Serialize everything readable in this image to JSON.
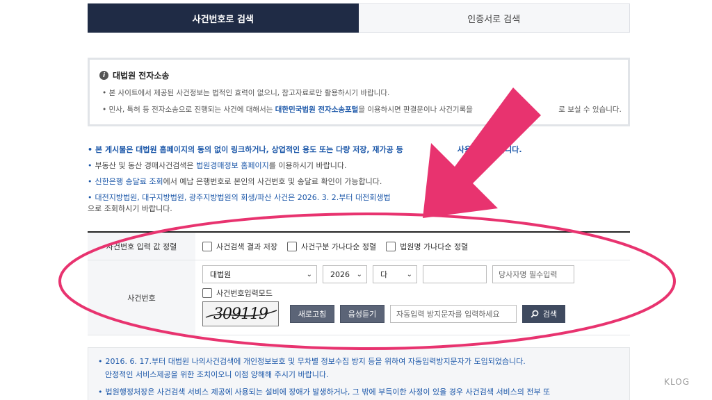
{
  "tabs": [
    {
      "label": "사건번호로 검색",
      "active": true
    },
    {
      "label": "인증서로 검색",
      "active": false
    }
  ],
  "notice": {
    "title": "대법원 전자소송",
    "line1": "본 사이트에서 제공된 사건정보는 법적인 효력이 없으니, 참고자료로만 활용하시기 바랍니다.",
    "line2_pre": "민사, 특허 등 전자소송으로 진행되는 사건에 대해서는 ",
    "line2_link": "대한민국법원 전자소송포털",
    "line2_post": "을 이용하시면 판결문이나 사건기록을 ",
    "line2_end": "로 보실 수 있습니다."
  },
  "bullets": {
    "b1_pre": "본 게시물은 대법원 홈페이지의 동의 없이 링크하거나, 상업적인 용도 또는 다량 저장, 재가공 등",
    "b1_end": "사용할 수 없습니다.",
    "b2_pre": "부동산 및 동산 경매사건검색은 ",
    "b2_link": "법원경매정보 홈페이지",
    "b2_post": "를 이용하시기 바랍니다.",
    "b3_link": "신한은행 송달료 조회",
    "b3_post": "에서 예납 은행번호로 본인의 사건번호 및 송달료 확인이 가능합니다.",
    "b4_pre": "대전지방법원, 대구지방법원, 광주지방법원의 회생/파산 사건은 2026. 3. 2.부터 대전회생법",
    "b4_end": "원, 광주회생법원",
    "b4_line2": "으로 조회하시기 바랍니다."
  },
  "form": {
    "row1_label": "사건번호 입력 값 정렬",
    "checks": [
      "사건검색 결과 저장",
      "사건구분 가나다순 정렬",
      "법원명 가나다순 정렬"
    ],
    "row2_label": "사건번호",
    "court_value": "대법원",
    "year_value": "2026",
    "type_value": "다",
    "number_value": "",
    "party_placeholder": "당사자명 필수입력",
    "mode_label": "사건번호입력모드",
    "captcha_text": "309119",
    "refresh_label": "새로고침",
    "audio_label": "음성듣기",
    "captcha_placeholder": "자동입력 방지문자를 입력하세요",
    "search_label": "검색"
  },
  "info": {
    "i1_line1": "2016. 6. 17.부터 대법원 나의사건검색에 개인정보보호 및 무차별 정보수집 방지 등을 위하여 자동입력방지문자가 도입되었습니다.",
    "i1_line2": "안정적인 서비스제공을 위한 조치이오니 이점 양해해 주시기 바랍니다.",
    "i2_line1": "법원행정처장은 사건검색 서비스 제공에 사용되는 설비에 장애가 발생하거나, 그 밖에 부득이한 사정이 있을 경우 사건검색 서비스의 전부 또"
  },
  "watermark": "KLOG",
  "colors": {
    "tab_active": "#1f2b45",
    "link_blue": "#1a56a8",
    "annotation_pink": "#e8336f"
  }
}
